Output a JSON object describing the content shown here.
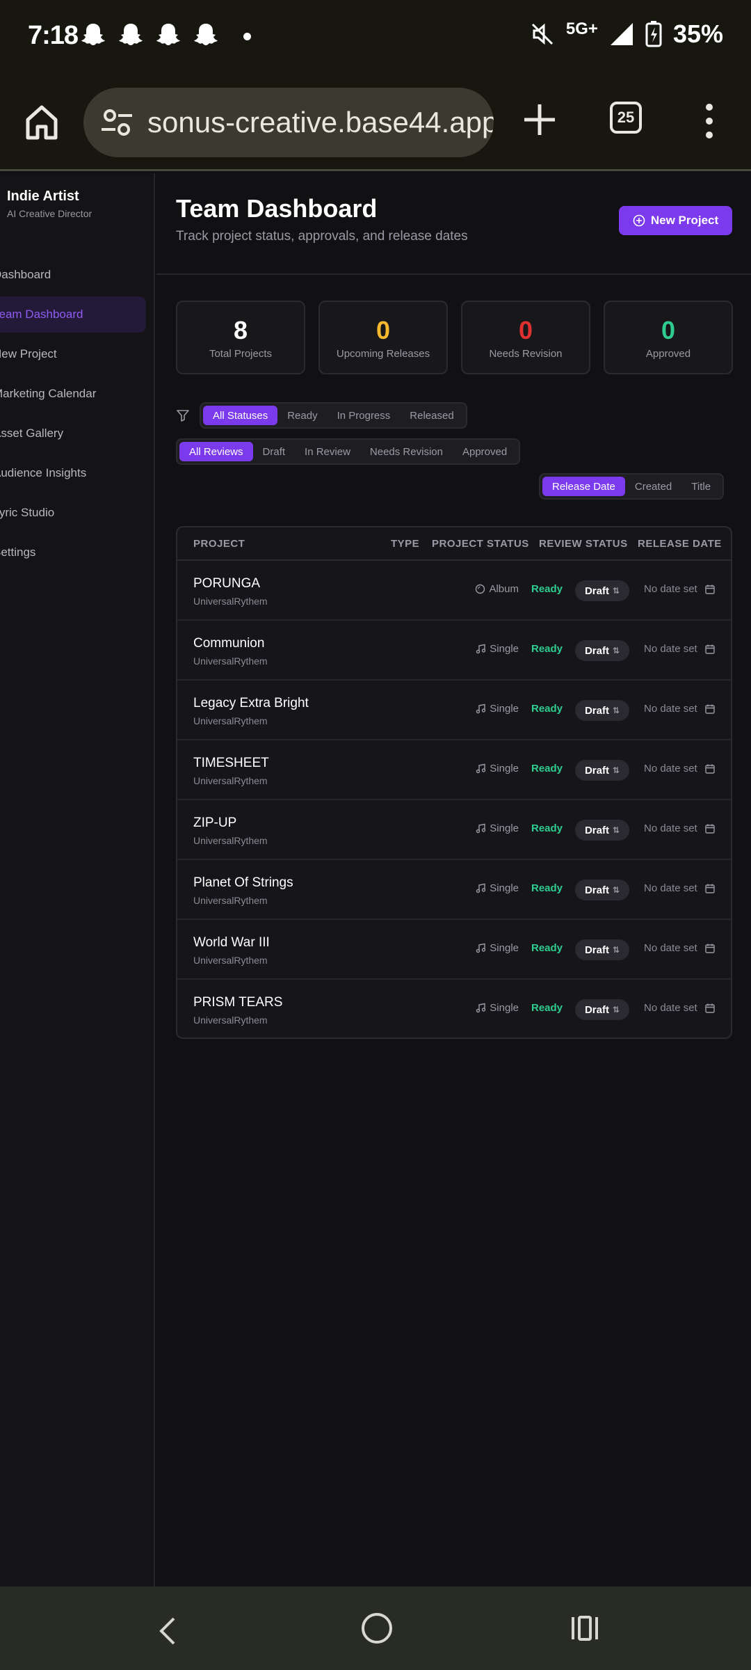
{
  "status_bar": {
    "time": "7:18",
    "network": "5G+",
    "battery": "35%"
  },
  "browser": {
    "url": "sonus-creative.base44.app",
    "tab_count": "25"
  },
  "sidebar": {
    "brand_title": "Indie Artist",
    "brand_subtitle": "AI Creative Director",
    "items": [
      {
        "label": "Dashboard",
        "active": false
      },
      {
        "label": "Team Dashboard",
        "active": true
      },
      {
        "label": "New Project",
        "active": false
      },
      {
        "label": "Marketing Calendar",
        "active": false
      },
      {
        "label": "Asset Gallery",
        "active": false
      },
      {
        "label": "Audience Insights",
        "active": false
      },
      {
        "label": "Lyric Studio",
        "active": false
      },
      {
        "label": "Settings",
        "active": false
      }
    ]
  },
  "header": {
    "title": "Team Dashboard",
    "subtitle": "Track project status, approvals, and release dates",
    "new_project_label": "New Project"
  },
  "stats": [
    {
      "value": "8",
      "label": "Total Projects",
      "color": "#ffffff"
    },
    {
      "value": "0",
      "label": "Upcoming Releases",
      "color": "#f5b82e"
    },
    {
      "value": "0",
      "label": "Needs Revision",
      "color": "#e03131"
    },
    {
      "value": "0",
      "label": "Approved",
      "color": "#2ecc8f"
    }
  ],
  "filters": {
    "status": [
      "All Statuses",
      "Ready",
      "In Progress",
      "Released"
    ],
    "review": [
      "All Reviews",
      "Draft",
      "In Review",
      "Needs Revision",
      "Approved"
    ],
    "sort": [
      "Release Date",
      "Created",
      "Title"
    ]
  },
  "table": {
    "headers": {
      "project": "PROJECT",
      "type": "TYPE",
      "project_status": "PROJECT STATUS",
      "review_status": "REVIEW STATUS",
      "release_date": "RELEASE DATE"
    },
    "rows": [
      {
        "title": "PORUNGA",
        "artist": "UniversalRythem",
        "type": "Album",
        "type_icon": "disc-icon",
        "status": "Ready",
        "review": "Draft",
        "date": "No date set"
      },
      {
        "title": "Communion",
        "artist": "UniversalRythem",
        "type": "Single",
        "type_icon": "music-note-icon",
        "status": "Ready",
        "review": "Draft",
        "date": "No date set"
      },
      {
        "title": "Legacy Extra Bright",
        "artist": "UniversalRythem",
        "type": "Single",
        "type_icon": "music-note-icon",
        "status": "Ready",
        "review": "Draft",
        "date": "No date set"
      },
      {
        "title": "TIMESHEET",
        "artist": "UniversalRythem",
        "type": "Single",
        "type_icon": "music-note-icon",
        "status": "Ready",
        "review": "Draft",
        "date": "No date set"
      },
      {
        "title": "ZIP-UP",
        "artist": "UniversalRythem",
        "type": "Single",
        "type_icon": "music-note-icon",
        "status": "Ready",
        "review": "Draft",
        "date": "No date set"
      },
      {
        "title": "Planet Of Strings",
        "artist": "UniversalRythem",
        "type": "Single",
        "type_icon": "music-note-icon",
        "status": "Ready",
        "review": "Draft",
        "date": "No date set"
      },
      {
        "title": "World War III",
        "artist": "UniversalRythem",
        "type": "Single",
        "type_icon": "music-note-icon",
        "status": "Ready",
        "review": "Draft",
        "date": "No date set"
      },
      {
        "title": "PRISM TEARS",
        "artist": "UniversalRythem",
        "type": "Single",
        "type_icon": "music-note-icon",
        "status": "Ready",
        "review": "Draft",
        "date": "No date set"
      }
    ]
  },
  "colors": {
    "accent": "#7c3aed",
    "ready": "#2ecc8f"
  }
}
